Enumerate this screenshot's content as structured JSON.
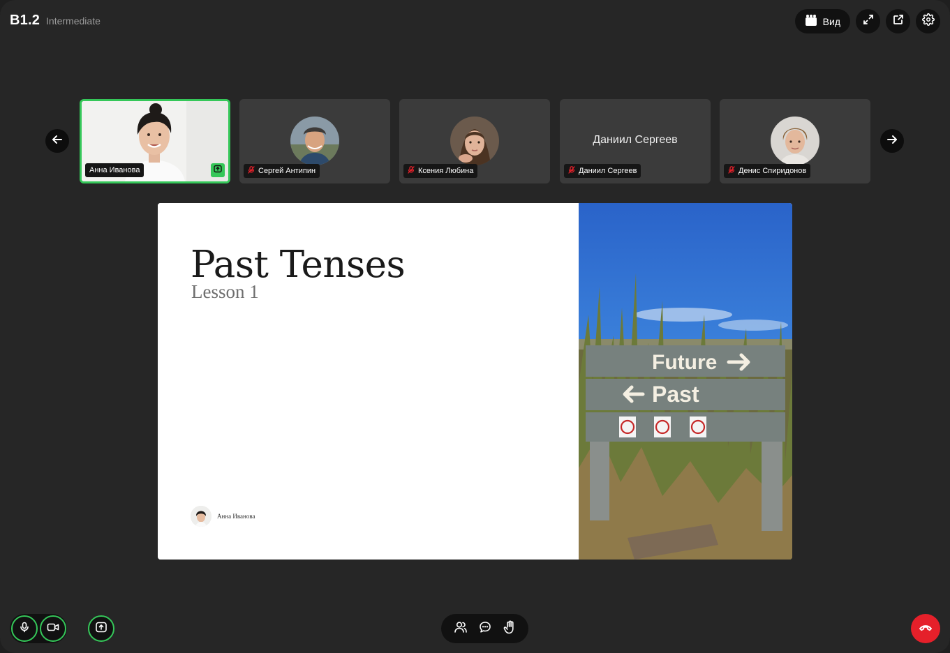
{
  "header": {
    "course_code": "B1.2",
    "course_level": "Intermediate",
    "view_label": "Вид",
    "icons": [
      "grid-view-icon",
      "fullscreen-icon",
      "external-window-icon",
      "gear-icon"
    ]
  },
  "participants": [
    {
      "name": "Анна Иванова",
      "active": true,
      "sharing": true,
      "muted": false,
      "video": "photo"
    },
    {
      "name": "Сергей Антипин",
      "active": false,
      "muted": true,
      "video": "avatar"
    },
    {
      "name": "Ксения Любина",
      "active": false,
      "muted": true,
      "video": "avatar"
    },
    {
      "name": "Даниил Сергеев",
      "display_name": "Даниил Сергеев",
      "active": false,
      "muted": true,
      "video": "none"
    },
    {
      "name": "Денис Спиридонов",
      "active": false,
      "muted": true,
      "video": "avatar"
    }
  ],
  "slide": {
    "title": "Past Tenses",
    "subtitle": "Lesson 1",
    "author": "Анна Иванова",
    "photo_signs": {
      "top": "Future",
      "middle": "Past"
    }
  },
  "controls": {
    "left": [
      "microphone-icon",
      "camera-icon",
      "share-screen-icon"
    ],
    "center": [
      "participants-icon",
      "chat-icon",
      "raise-hand-icon"
    ],
    "right": [
      "end-call-icon"
    ]
  },
  "colors": {
    "background": "#262626",
    "tile": "#3b3b3b",
    "accent_green": "#35c759",
    "end_call_red": "#e5202a"
  }
}
